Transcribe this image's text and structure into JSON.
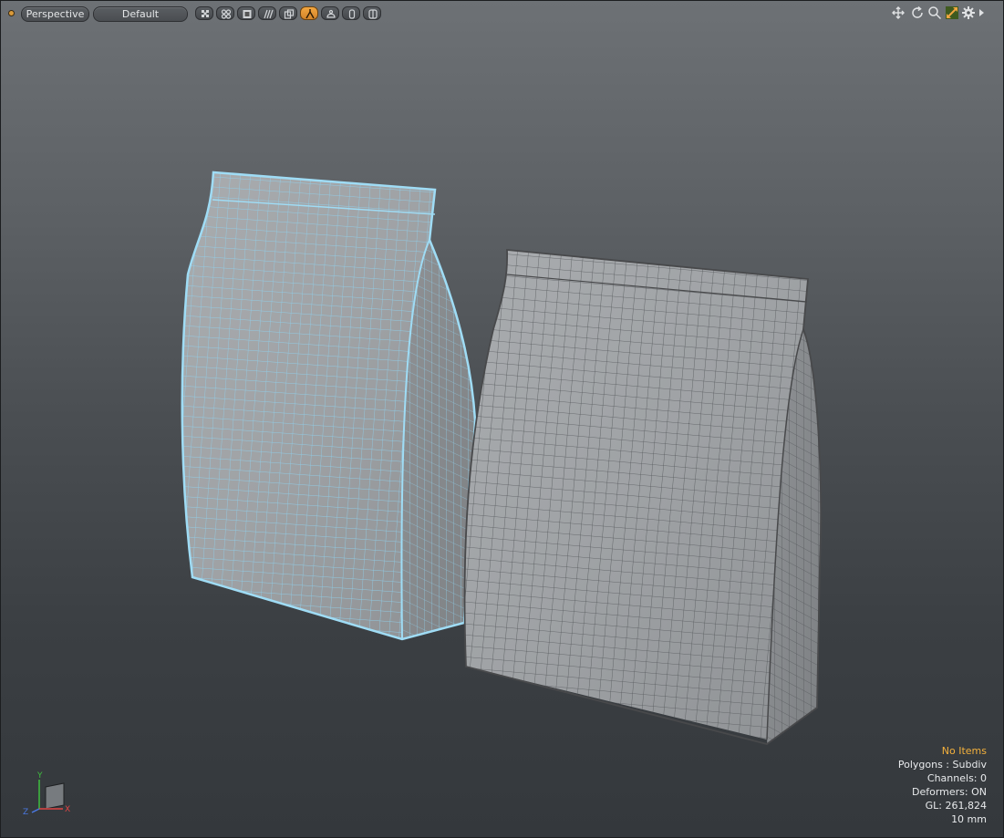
{
  "toolbar": {
    "view_label": "Perspective",
    "style_label": "Default",
    "view_buttons": [
      {
        "name": "checker-display-icon",
        "active": false
      },
      {
        "name": "vertex-display-icon",
        "active": false
      },
      {
        "name": "solid-shade-icon",
        "active": false
      },
      {
        "name": "wire-shade-icon",
        "active": false
      },
      {
        "name": "texture-shade-icon",
        "active": false
      },
      {
        "name": "advanced-shade-icon",
        "active": true
      },
      {
        "name": "reflection-shade-icon",
        "active": false
      },
      {
        "name": "shadow-shade-icon",
        "active": false
      },
      {
        "name": "ambient-occlusion-icon",
        "active": false
      }
    ],
    "right_icons": [
      "move-view-icon",
      "rotate-view-icon",
      "zoom-view-icon",
      "fit-view-icon",
      "settings-gear-icon",
      "expand-arrow-icon"
    ]
  },
  "info": {
    "items": "No Items",
    "polygons": "Polygons : Subdiv",
    "channels": "Channels: 0",
    "deformers": "Deformers: ON",
    "gl": "GL: 261,824",
    "scale": "10 mm"
  },
  "axis": {
    "y": "Y",
    "z": "Z",
    "x": "X"
  },
  "colors": {
    "accent": "#f1a640",
    "selection_wire": "#8fd2ef",
    "mesh_wire": "#4a4d50",
    "warning_text": "#f4b13c"
  }
}
